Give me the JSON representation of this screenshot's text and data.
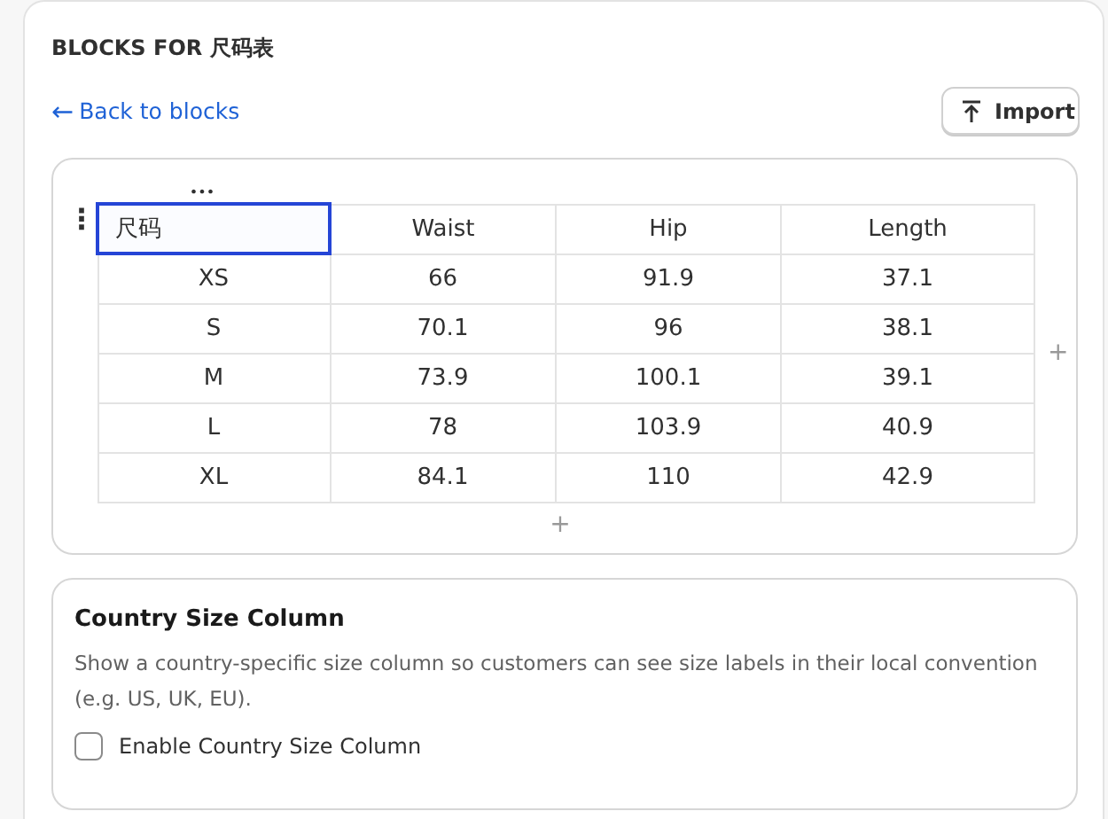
{
  "panel": {
    "title": "BLOCKS FOR 尺码表"
  },
  "back_link": {
    "icon": "←",
    "label": "Back to blocks"
  },
  "import_button": {
    "label": "Import"
  },
  "table": {
    "column_menu": "•••",
    "row_menu": "⋮",
    "add_column": "+",
    "add_row": "+",
    "header": [
      {
        "text": "尺码",
        "selected": true
      },
      {
        "text": "Waist",
        "selected": false
      },
      {
        "text": "Hip",
        "selected": false
      },
      {
        "text": "Length",
        "selected": false
      }
    ],
    "rows": [
      [
        "XS",
        "66",
        "91.9",
        "37.1"
      ],
      [
        "S",
        "70.1",
        "96",
        "38.1"
      ],
      [
        "M",
        "73.9",
        "100.1",
        "39.1"
      ],
      [
        "L",
        "78",
        "103.9",
        "40.9"
      ],
      [
        "XL",
        "84.1",
        "110",
        "42.9"
      ]
    ]
  },
  "settings_card": {
    "title": "Country Size Column",
    "description": "Show a country-specific size column so customers can see size labels in their local convention (e.g. US, UK, EU).",
    "checkbox": {
      "label": "Enable Country Size Column",
      "checked": false
    }
  }
}
